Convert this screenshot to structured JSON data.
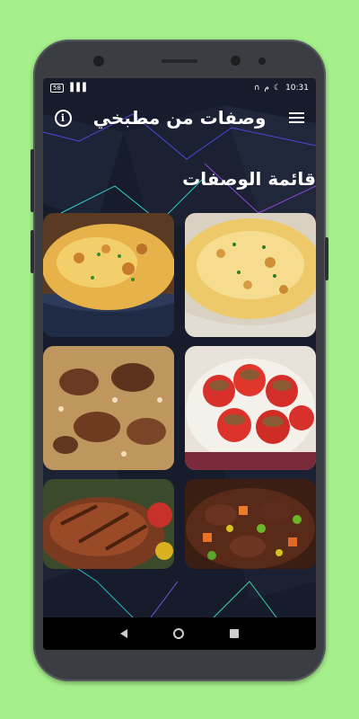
{
  "status_bar": {
    "time": "10:31",
    "am_pm": "م",
    "battery_label": "58",
    "icons": [
      "headphones-icon",
      "moon-icon",
      "battery-icon",
      "signal-icon"
    ]
  },
  "app_bar": {
    "title": "وصفات من مطبخي",
    "info_icon": "info-icon",
    "menu_icon": "menu-icon"
  },
  "section": {
    "title": "قائمة الوصفات"
  },
  "recipes": [
    {
      "image": "cheesy-gratin"
    },
    {
      "image": "potato-casserole"
    },
    {
      "image": "stuffed-tomatoes"
    },
    {
      "image": "meat-rice-pilaf"
    },
    {
      "image": "vegetable-stew"
    },
    {
      "image": "grilled-steak"
    }
  ],
  "colors": {
    "page_bg": "#a6f08c",
    "screen_bg": "#161b2c",
    "text": "#ffffff"
  }
}
